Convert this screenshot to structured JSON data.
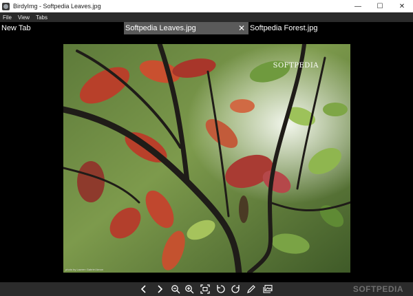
{
  "window": {
    "title": "BirdyImg - Softpedia Leaves.jpg",
    "minimize": "—",
    "maximize": "☐",
    "close": "✕"
  },
  "menu": {
    "items": [
      "File",
      "View",
      "Tabs"
    ]
  },
  "tabs": [
    {
      "label": "New Tab",
      "active": false
    },
    {
      "label": "Softpedia Leaves.jpg",
      "active": true,
      "close": "✕"
    },
    {
      "label": "Softpedia Forest.jpg",
      "active": false
    }
  ],
  "image": {
    "watermark": "SOFTPEDIA",
    "credit": "photo by Lawren Gabriel Aman"
  },
  "toolbar": {
    "icons": [
      "chevron-left-icon",
      "chevron-right-icon",
      "zoom-out-icon",
      "zoom-in-icon",
      "fit-screen-icon",
      "rotate-left-icon",
      "rotate-right-icon",
      "edit-pencil-icon",
      "gallery-icon"
    ]
  },
  "brand": {
    "mark": "SOFTPEDIA"
  }
}
